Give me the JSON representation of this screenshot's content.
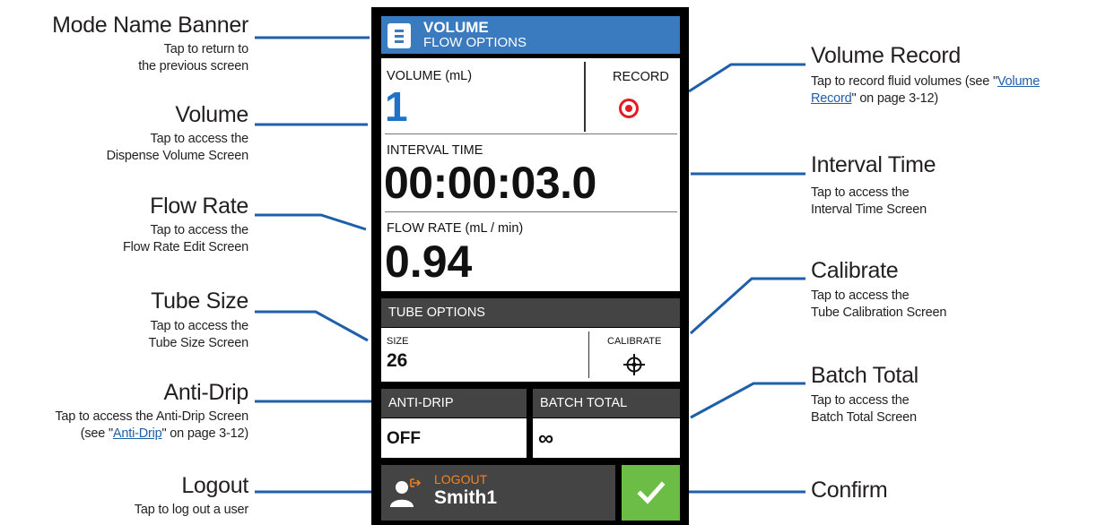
{
  "annotations_left": [
    {
      "title": "Mode Name Banner",
      "desc": [
        "Tap to return to",
        "the previous screen"
      ]
    },
    {
      "title": "Volume",
      "desc": [
        "Tap to access the",
        "Dispense Volume Screen"
      ]
    },
    {
      "title": "Flow Rate",
      "desc": [
        "Tap to access the",
        "Flow Rate Edit Screen"
      ]
    },
    {
      "title": "Tube Size",
      "desc": [
        "Tap to access the",
        "Tube Size Screen"
      ]
    },
    {
      "title": "Anti-Drip",
      "desc": [
        "Tap to access the Anti-Drip Screen"
      ],
      "ref_pre": "(see \"",
      "ref_link": "Anti-Drip",
      "ref_post": "\" on page 3-12)"
    },
    {
      "title": "Logout",
      "desc": [
        "Tap to log out a user"
      ]
    }
  ],
  "annotations_right": {
    "volume_record": {
      "title": "Volume Record",
      "desc_pre": "Tap to record fluid volumes (see \"",
      "link1": "Volume",
      "link2": "Record",
      "desc_post": "\" on page 3-12)"
    },
    "interval_time": {
      "title": "Interval Time",
      "desc": [
        "Tap to access the",
        "Interval Time Screen"
      ]
    },
    "calibrate": {
      "title": "Calibrate",
      "desc": [
        "Tap to access the",
        "Tube Calibration Screen"
      ]
    },
    "batch_total": {
      "title": "Batch Total",
      "desc": [
        "Tap to access the",
        "Batch Total Screen"
      ]
    },
    "confirm": {
      "title": "Confirm"
    }
  },
  "screen": {
    "banner": {
      "title": "VOLUME",
      "subtitle": "FLOW OPTIONS",
      "icon": "menu-document-icon"
    },
    "volume": {
      "label": "VOLUME (mL)",
      "value": "1"
    },
    "record": {
      "label": "RECORD",
      "icon": "record-icon"
    },
    "interval": {
      "label": "INTERVAL TIME",
      "value": "00:00:03.0"
    },
    "flow_rate": {
      "label": "FLOW RATE (mL / min)",
      "value": "0.94"
    },
    "tube_options": {
      "header": "TUBE OPTIONS",
      "size_label": "SIZE",
      "size_value": "26",
      "calibrate_label": "CALIBRATE",
      "calibrate_icon": "crosshair-icon"
    },
    "anti_drip": {
      "header": "ANTI-DRIP",
      "value": "OFF"
    },
    "batch_total": {
      "header": "BATCH TOTAL",
      "value": "∞"
    },
    "logout": {
      "label": "LOGOUT",
      "user": "Smith1",
      "icon": "user-logout-icon"
    },
    "confirm": {
      "icon": "checkmark-icon"
    }
  },
  "colors": {
    "banner": "#3a7bbf",
    "accent_blue": "#1f73c7",
    "record_red": "#e31b23",
    "logout_orange": "#f58220",
    "confirm_green": "#6cbd45",
    "dark_header": "#444444",
    "leader_line": "#1f5faa"
  }
}
